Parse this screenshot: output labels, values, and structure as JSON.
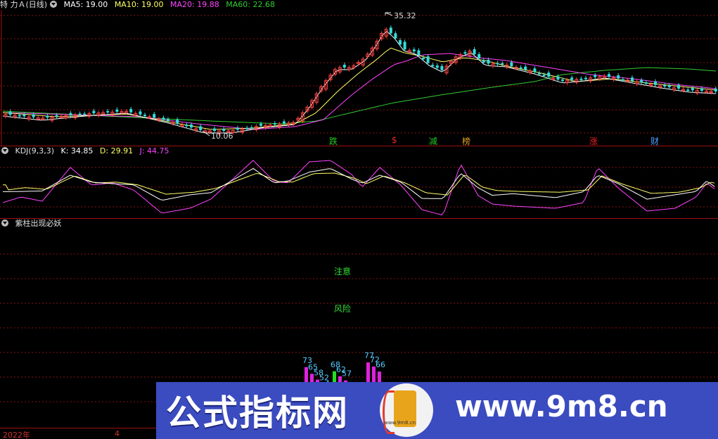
{
  "main_panel": {
    "title": "特 力Ａ(日线)",
    "ma5": "MA5: 19.00",
    "ma10": "MA10: 19.00",
    "ma20": "MA20: 19.88",
    "ma60": "MA60: 22.68",
    "high_label": "35.32",
    "low_label": "10.06",
    "event_markers": [
      {
        "text": "跌",
        "color": "#22cc22"
      },
      {
        "text": "$",
        "color": "#ee2222"
      },
      {
        "text": "减",
        "color": "#22cc22"
      },
      {
        "text": "榜",
        "color": "#e0a020"
      },
      {
        "text": "涨",
        "color": "#ee2222"
      },
      {
        "text": "财",
        "color": "#4aa0ff"
      }
    ],
    "colors": {
      "ma5": "#ffffff",
      "ma10": "#ffff66",
      "ma20": "#ff44ff",
      "ma60": "#33cc33",
      "up": "#ff4444",
      "down": "#33dddd"
    }
  },
  "kdj_panel": {
    "title": "KDJ(9,3,3)",
    "k": "K: 34.85",
    "d": "D: 29.91",
    "j": "J: 44.75"
  },
  "indicator_panel": {
    "title": "紫柱出现必妖",
    "notice": "注意",
    "risk": "风险",
    "bars": [
      {
        "label": "73",
        "value": 73,
        "color": "#dd22dd"
      },
      {
        "label": "65",
        "value": 65,
        "color": "#dd22dd"
      },
      {
        "label": "58",
        "value": 58,
        "color": "#dd22dd"
      },
      {
        "label": "52",
        "value": 52,
        "color": "#dd22dd"
      },
      {
        "label": "4",
        "value": 45,
        "color": "#dd22dd"
      },
      {
        "label": "68",
        "value": 68,
        "color": "#22dd22"
      },
      {
        "label": "62",
        "value": 62,
        "color": "#dd22dd"
      },
      {
        "label": "57",
        "value": 57,
        "color": "#dd22dd"
      },
      {
        "label": "77",
        "value": 77,
        "color": "#dd22dd"
      },
      {
        "label": "72",
        "value": 72,
        "color": "#dd22dd"
      },
      {
        "label": "66",
        "value": 66,
        "color": "#dd22dd"
      }
    ]
  },
  "time_axis": {
    "year": "2022年",
    "month": "4"
  },
  "watermark": {
    "chinese": "公式指标网",
    "url": "www.9m8.cn",
    "logo_text": "www.9m8.cn"
  }
}
